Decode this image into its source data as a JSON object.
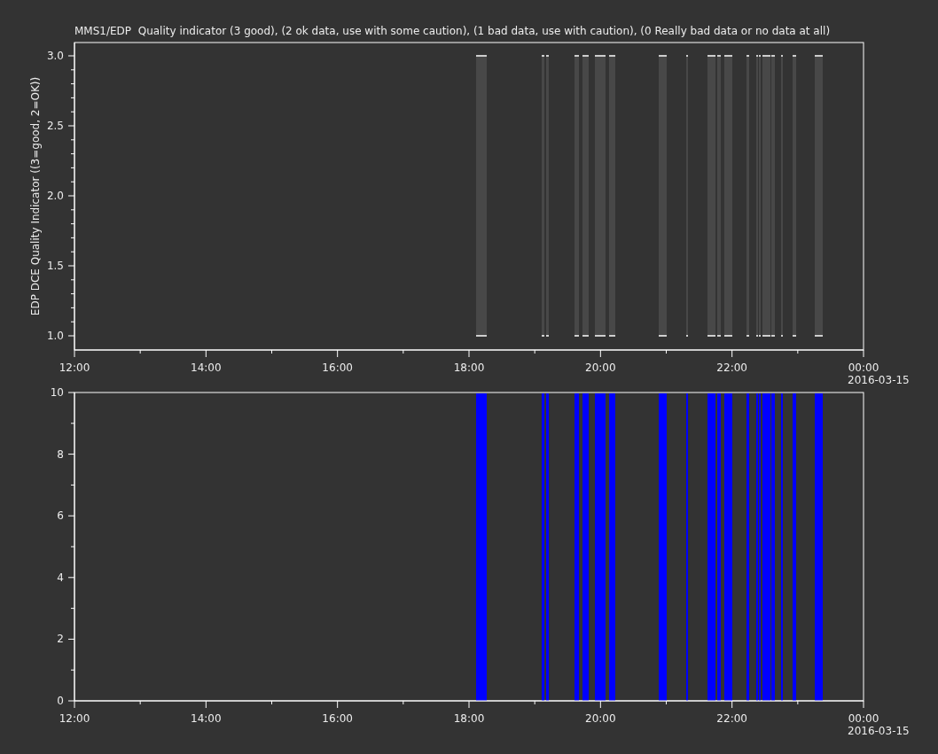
{
  "title": "MMS1/EDP  Quality indicator (3 good), (2 ok data, use with some caution), (1 bad data, use with caution), (0 Really bad data or no data at all)",
  "panels": [
    {
      "kind": "quality",
      "ylabel": "EDP DCE Quality Indicator ((3=good, 2=OK))",
      "yticks": [
        "3.0",
        "2.5",
        "2.0",
        "1.5",
        "1.0"
      ],
      "xticks": [
        "12:00",
        "14:00",
        "16:00",
        "18:00",
        "20:00",
        "22:00",
        "00:00"
      ],
      "date": "2016-03-15"
    },
    {
      "kind": "flag",
      "yticks": [
        "10",
        "8",
        "6",
        "4",
        "2",
        "0"
      ],
      "xticks": [
        "12:00",
        "14:00",
        "16:00",
        "18:00",
        "20:00",
        "22:00",
        "00:00"
      ],
      "date": "2016-03-15"
    }
  ]
}
